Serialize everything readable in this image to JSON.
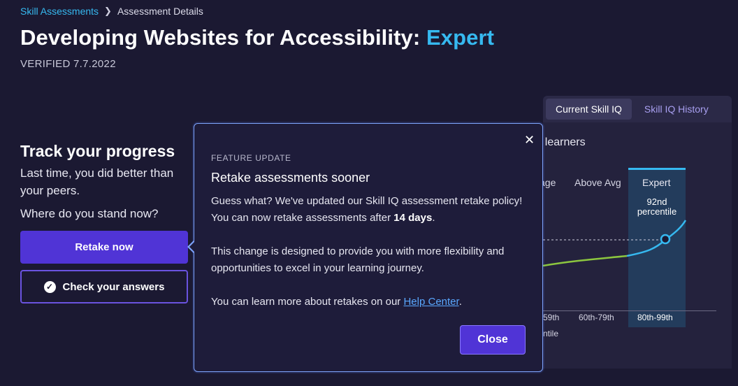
{
  "breadcrumb": {
    "parent": "Skill Assessments",
    "current": "Assessment Details"
  },
  "header": {
    "title": "Developing Websites for Accessibility:",
    "level": "Expert",
    "verified": "VERIFIED 7.7.2022"
  },
  "progress": {
    "title": "Track your progress",
    "desc_line1": "Last time, you did better than",
    "desc_line2": "your peers.",
    "question": "Where do you stand now?",
    "retake_label": "Retake now",
    "check_label": "Check your answers"
  },
  "panel": {
    "tabs": [
      {
        "label": "Current Skill IQ"
      },
      {
        "label": "Skill IQ History"
      }
    ],
    "peers_label": "r learners",
    "columns": [
      {
        "label": "age",
        "range": "59th"
      },
      {
        "label": "Above Avg",
        "range": "60th-79th"
      },
      {
        "label": "Expert",
        "range": "80th-99th"
      }
    ],
    "percentile_line1": "92nd",
    "percentile_line2": "percentile",
    "tile_label": "ntile"
  },
  "modal": {
    "eyebrow": "FEATURE UPDATE",
    "heading": "Retake assessments sooner",
    "p1_text": "Guess what? We've updated our Skill IQ assessment retake policy! You can now retake assessments after ",
    "p1_bold": "14 days",
    "p1_end": ".",
    "p2": "This change is designed to provide you with more flexibility and opportunities to excel in your learning journey.",
    "p3_text": "You can learn more about retakes on our ",
    "p3_link": "Help Center",
    "p3_end": ".",
    "close_label": "Close",
    "close_x": "✕"
  },
  "colors": {
    "accent": "#36b9f0",
    "primary": "#5034d6",
    "background": "#1b1932"
  }
}
